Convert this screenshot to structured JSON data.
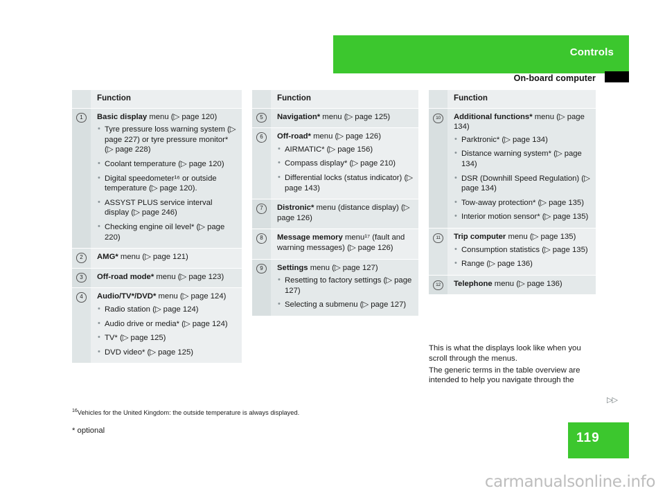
{
  "header": {
    "section_title": "Controls",
    "sub_title": "On-board computer",
    "accent_color": "#3cc72e",
    "marker_color": "#000000"
  },
  "page": {
    "number": "119",
    "continuation_arrow": "▷▷",
    "watermark": "carmanualsonline.info"
  },
  "tables": [
    {
      "header": "Function",
      "rows": [
        {
          "num": "1",
          "title": "Basic display",
          "title_suffix": " menu (▷ page 120)",
          "bullets": [
            "Tyre pressure loss warning system (▷ page 227) or tyre pressure monitor* (▷ page 228)",
            "Coolant temperature (▷ page 120)",
            "Digital speedometer¹⁶ or outside temperature (▷ page 120).",
            "ASSYST PLUS service interval display (▷ page 246)",
            "Checking engine oil level* (▷ page 220)"
          ]
        },
        {
          "num": "2",
          "title": "AMG*",
          "title_suffix": " menu (▷ page 121)",
          "bullets": []
        },
        {
          "num": "3",
          "title": "Off-road mode*",
          "title_suffix": " menu (▷ page 123)",
          "bullets": []
        },
        {
          "num": "4",
          "title": "Audio/TV*/DVD*",
          "title_suffix": " menu (▷ page 124)",
          "bullets": [
            "Radio station (▷ page 124)",
            "Audio drive or media* (▷ page 124)",
            "TV* (▷ page 125)",
            "DVD video* (▷ page 125)"
          ]
        }
      ]
    },
    {
      "header": "Function",
      "rows": [
        {
          "num": "5",
          "title": "Navigation*",
          "title_suffix": " menu (▷ page 125)",
          "bullets": []
        },
        {
          "num": "6",
          "title": "Off-road*",
          "title_suffix": " menu (▷ page 126)",
          "bullets": [
            "AIRMATIC* (▷ page 156)",
            "Compass display* (▷ page 210)",
            "Differential locks (status indicator) (▷ page 143)"
          ]
        },
        {
          "num": "7",
          "title": "Distronic*",
          "title_suffix": " menu (distance display) (▷ page 126)",
          "bullets": []
        },
        {
          "num": "8",
          "title": "Message memory",
          "title_suffix": " menu¹⁷ (fault and warning messages) (▷ page 126)",
          "bullets": []
        },
        {
          "num": "9",
          "title": "Settings",
          "title_suffix": " menu (▷ page 127)",
          "bullets": [
            "Resetting to factory settings (▷ page 127)",
            "Selecting a submenu (▷ page 127)"
          ]
        }
      ]
    },
    {
      "header": "Function",
      "rows": [
        {
          "num": "10",
          "title": "Additional functions*",
          "title_suffix": " menu (▷ page 134)",
          "bullets": [
            "Parktronic* (▷ page 134)",
            "Distance warning system* (▷ page 134)",
            "DSR (Downhill Speed Regulation) (▷ page 134)",
            "Tow-away protection* (▷ page 135)",
            "Interior motion sensor* (▷ page 135)"
          ]
        },
        {
          "num": "11",
          "title": "Trip computer",
          "title_suffix": " menu (▷ page 135)",
          "bullets": [
            "Consumption statistics (▷ page 135)",
            "Range (▷ page 136)"
          ]
        },
        {
          "num": "12",
          "title": "Telephone",
          "title_suffix": " menu (▷ page 136)",
          "bullets": []
        }
      ]
    }
  ],
  "body_text": {
    "paragraph_1": "This is what the displays look like when you scroll through the menus.",
    "paragraph_2": "The generic terms in the table overview are intended to help you navigate through the"
  },
  "footnotes": {
    "marker_16": "16",
    "note_16": "Vehicles for the United Kingdom: the outside temperature is always displayed.",
    "note_optional": "* optional"
  }
}
